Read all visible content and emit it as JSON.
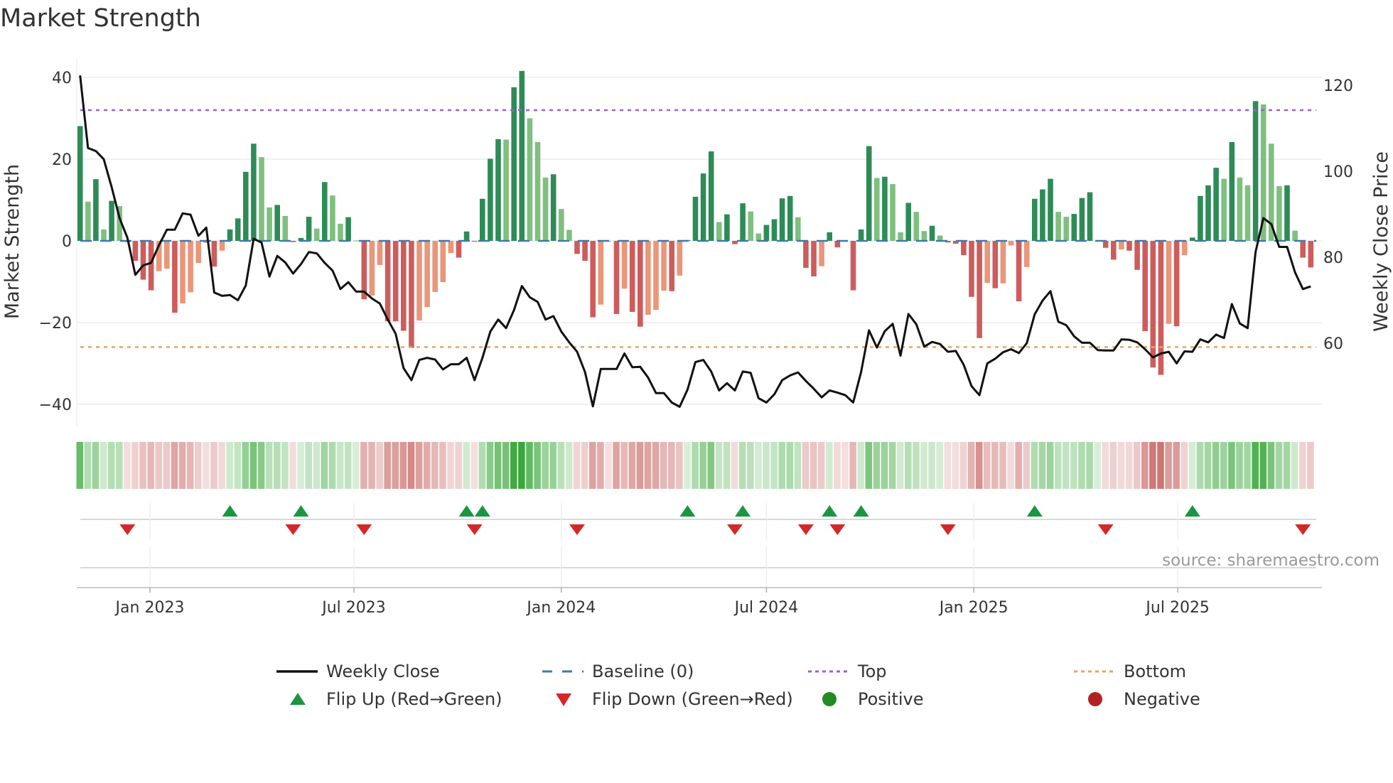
{
  "title": "Market Strength",
  "source": "source: sharemaestro.com",
  "chart_data": {
    "type": "bar",
    "title": "Market Strength",
    "ylabel": "Market Strength",
    "y2label": "Weekly Close Price",
    "ylim": [
      -45,
      45
    ],
    "y2lim": [
      41,
      126
    ],
    "yticks": [
      40,
      20,
      0,
      -20,
      -40
    ],
    "yticklabels": [
      "40",
      "20",
      "0",
      "−20",
      "−40"
    ],
    "y2ticks": [
      120,
      100,
      80,
      60
    ],
    "y2ticklabels": [
      "120",
      "100",
      "80",
      "60"
    ],
    "frequency": "weekly",
    "start_date": "2022-10-31",
    "xticks": [
      {
        "date": "2023-01-01",
        "label": "Jan 2023"
      },
      {
        "date": "2023-07-01",
        "label": "Jul 2023"
      },
      {
        "date": "2024-01-01",
        "label": "Jan 2024"
      },
      {
        "date": "2024-07-01",
        "label": "Jul 2024"
      },
      {
        "date": "2025-01-01",
        "label": "Jan 2025"
      },
      {
        "date": "2025-07-01",
        "label": "Jul 2025"
      }
    ],
    "top_level": 32,
    "bottom_level": -26,
    "baseline": 0,
    "strength": [
      28.1,
      9.6,
      15.1,
      2.8,
      9.8,
      8.5,
      -0.3,
      -4.9,
      -9.5,
      -12.1,
      -7.4,
      -6.8,
      -17.6,
      -15.3,
      -12.6,
      -5.4,
      -0.5,
      -6.3,
      -2.4,
      2.8,
      5.5,
      16.9,
      23.8,
      20.5,
      8.2,
      8.8,
      6.1,
      -0.3,
      0.7,
      5.9,
      3.0,
      14.4,
      11.1,
      4.2,
      5.8,
      0.1,
      -14.3,
      -13.4,
      -5.9,
      -19.7,
      -19.7,
      -22.0,
      -26.2,
      -19.5,
      -16.2,
      -12.5,
      -10.1,
      -3.0,
      -4.1,
      2.3,
      -0.2,
      10.3,
      20.1,
      24.9,
      24.8,
      37.6,
      41.6,
      30.0,
      24.2,
      15.5,
      16.3,
      7.8,
      2.7,
      -3.2,
      -4.9,
      -18.7,
      -15.6,
      -0.2,
      -17.9,
      -11.7,
      -17.4,
      -21.0,
      -18.1,
      -16.9,
      -12.2,
      -12.3,
      -8.5,
      0.2,
      10.8,
      16.5,
      21.9,
      4.6,
      6.5,
      -0.8,
      9.2,
      7.2,
      1.8,
      3.9,
      5.3,
      10.4,
      11.0,
      5.8,
      -6.6,
      -8.7,
      -6.2,
      2.1,
      -1.6,
      -0.2,
      -12.1,
      2.8,
      23.2,
      15.4,
      15.7,
      13.9,
      2.1,
      9.3,
      7.1,
      2.4,
      3.7,
      1.3,
      -0.4,
      -0.7,
      -3.5,
      -13.7,
      -23.8,
      -10.3,
      -11.6,
      -10.4,
      -1.1,
      -14.8,
      -6.4,
      10.3,
      12.6,
      15.2,
      7.1,
      5.9,
      6.6,
      10.5,
      11.9,
      0.1,
      -1.7,
      -4.6,
      -2.1,
      -2.4,
      -7.1,
      -22.1,
      -31.0,
      -32.8,
      -20.3,
      -20.9,
      -3.5,
      0.8,
      11.0,
      13.6,
      17.9,
      15.2,
      24.2,
      15.5,
      13.6,
      34.2,
      33.4,
      23.8,
      13.4,
      13.6,
      2.5,
      -4.1,
      -6.5
    ],
    "weekly_close": [
      122.3,
      105.4,
      104.7,
      102.8,
      96.3,
      89.1,
      84.5,
      75.9,
      78.1,
      78.7,
      82.8,
      86.4,
      86.4,
      90.2,
      89.9,
      85.0,
      86.9,
      71.8,
      71.0,
      71.2,
      70.0,
      73.4,
      84.3,
      83.4,
      75.5,
      80.3,
      78.8,
      76.2,
      78.4,
      81.2,
      80.9,
      78.7,
      76.9,
      72.6,
      74.2,
      72.0,
      72.0,
      70.4,
      69.2,
      65.5,
      62.2,
      54.2,
      51.4,
      56.1,
      56.6,
      56.2,
      53.9,
      55.1,
      55.1,
      56.6,
      51.4,
      56.6,
      62.7,
      65.5,
      63.5,
      67.7,
      73.3,
      70.7,
      69.6,
      65.5,
      66.3,
      62.7,
      60.2,
      58.0,
      53.3,
      45.3,
      54.0,
      54.0,
      54.0,
      57.6,
      54.4,
      54.5,
      52.0,
      48.4,
      48.4,
      46.2,
      45.2,
      49.2,
      55.6,
      56.1,
      53.4,
      49.0,
      50.7,
      49.0,
      53.4,
      53.1,
      47.2,
      46.2,
      48.1,
      51.4,
      52.5,
      53.2,
      51.2,
      49.4,
      47.4,
      49.0,
      48.5,
      47.9,
      46.2,
      53.3,
      63.0,
      59.0,
      62.8,
      64.5,
      57.1,
      66.8,
      64.4,
      59.2,
      60.3,
      59.8,
      58.0,
      58.2,
      55.0,
      50.0,
      47.9,
      55.3,
      56.4,
      57.9,
      58.6,
      57.7,
      60.0,
      66.7,
      69.9,
      72.1,
      65.0,
      64.2,
      61.6,
      60.1,
      60.1,
      58.4,
      58.3,
      58.3,
      60.9,
      60.8,
      60.2,
      58.6,
      56.7,
      57.6,
      58.0,
      55.3,
      58.1,
      58.0,
      60.9,
      60.2,
      62.0,
      61.2,
      69.1,
      64.6,
      63.5,
      81.2,
      89.1,
      87.7,
      82.4,
      82.4,
      76.5,
      72.6,
      73.2
    ],
    "flip_up_weeks": [
      19,
      28,
      49,
      51,
      77,
      84,
      95,
      99,
      121,
      141
    ],
    "flip_down_weeks": [
      6,
      27,
      36,
      50,
      63,
      83,
      92,
      96,
      110,
      130,
      155
    ],
    "legend": [
      {
        "label": "Weekly Close",
        "kind": "line",
        "color": "#111111"
      },
      {
        "label": "Baseline (0)",
        "kind": "dash",
        "color": "#3a7ab0"
      },
      {
        "label": "Top",
        "kind": "dot",
        "color": "#9b5fd6"
      },
      {
        "label": "Bottom",
        "kind": "dot",
        "color": "#f0a060"
      },
      {
        "label": "Flip Up (Red→Green)",
        "kind": "tri-up",
        "color": "#1a9641"
      },
      {
        "label": "Flip Down (Green→Red)",
        "kind": "tri-down",
        "color": "#d62728"
      },
      {
        "label": "Positive",
        "kind": "circle",
        "color": "#228b22"
      },
      {
        "label": "Negative",
        "kind": "circle",
        "color": "#b22222"
      }
    ],
    "legend_position": "bottom",
    "colors": {
      "pos_rising": "#2e8b57",
      "pos_falling": "#7fbf7f",
      "neg_falling": "#cd5c5c",
      "neg_rising": "#e9967a",
      "heat_pos": "#2ca02c",
      "heat_neg": "#c0504d",
      "flip_up": "#1a9641",
      "flip_down": "#d62728"
    },
    "grid": true
  }
}
